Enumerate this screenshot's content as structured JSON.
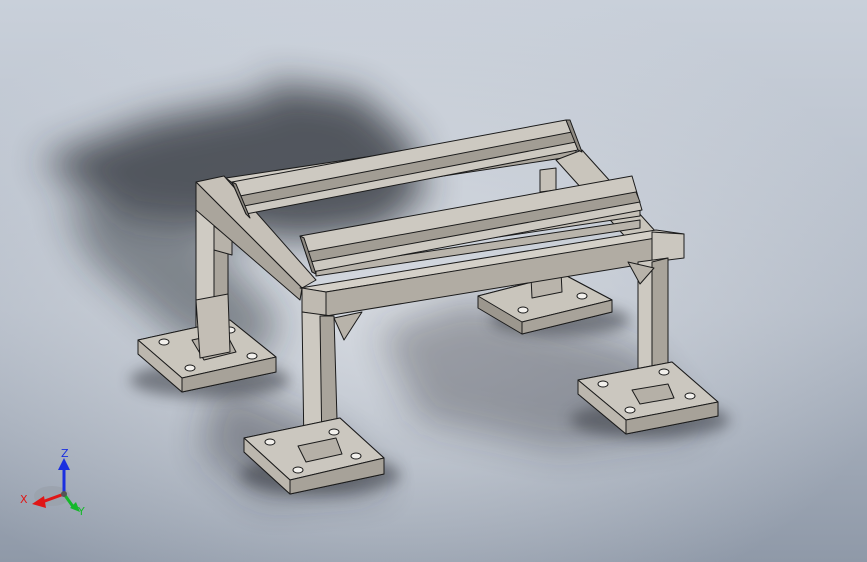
{
  "viewport": {
    "background_top": "#c9d0da",
    "background_bottom": "#8f99a8",
    "shadow_color": "#2a2e34"
  },
  "model": {
    "name": "steel-frame-stand",
    "face_color": "#c2bdb3",
    "face_light": "#d2cec6",
    "face_dark": "#9c978e",
    "edge_color": "#1b1b1b"
  },
  "triad": {
    "x_label": "X",
    "y_label": "Y",
    "z_label": "Z",
    "x_color": "#e01616",
    "y_color": "#15b82a",
    "z_color": "#1a2fe0"
  }
}
